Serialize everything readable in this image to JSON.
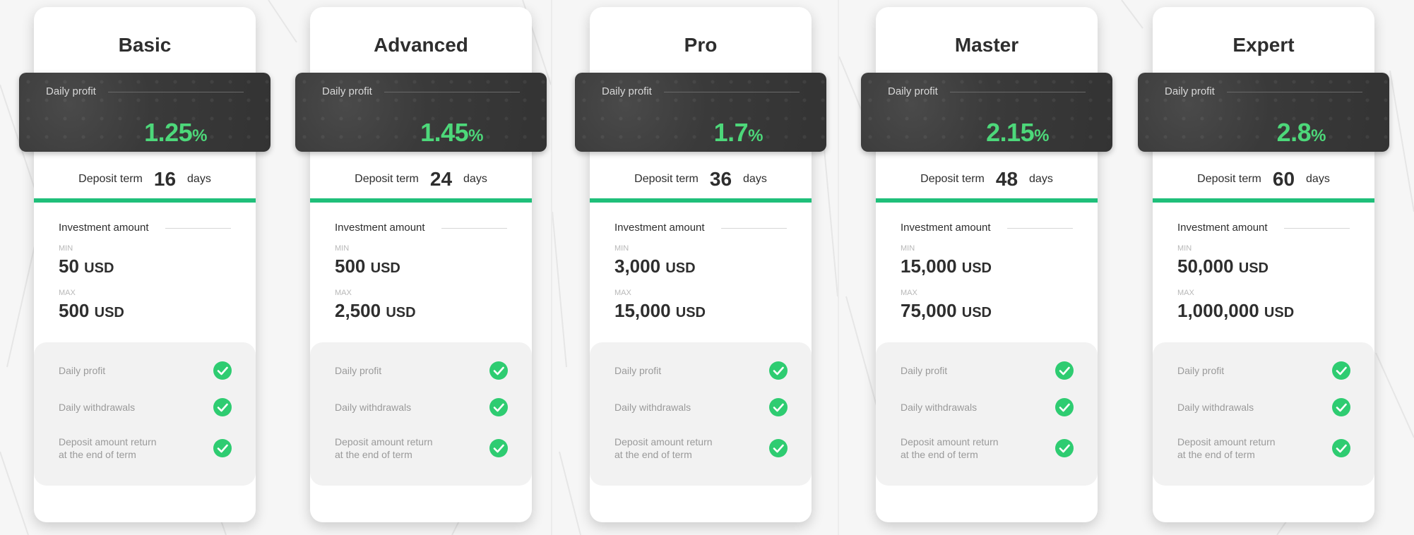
{
  "theme": {
    "accent": "#1fbf7a",
    "profit_color": "#4dd87a",
    "check_color": "#2ecc71",
    "panel_dark": "#383838"
  },
  "labels": {
    "daily_profit": "Daily profit",
    "deposit_term": "Deposit term",
    "days": "days",
    "investment_amount": "Investment amount",
    "min": "MIN",
    "max": "MAX",
    "currency": "USD",
    "percent": "%"
  },
  "features": [
    {
      "label": "Daily profit",
      "icon": "check-circle-icon"
    },
    {
      "label": "Daily withdrawals",
      "icon": "check-circle-icon"
    },
    {
      "label_line1": "Deposit amount return",
      "label_line2": "at the end of term",
      "icon": "check-circle-icon"
    }
  ],
  "plans": [
    {
      "name": "Basic",
      "daily_profit": "1.25",
      "term": "16",
      "min": "50",
      "max": "500"
    },
    {
      "name": "Advanced",
      "daily_profit": "1.45",
      "term": "24",
      "min": "500",
      "max": "2,500"
    },
    {
      "name": "Pro",
      "daily_profit": "1.7",
      "term": "36",
      "min": "3,000",
      "max": "15,000"
    },
    {
      "name": "Master",
      "daily_profit": "2.15",
      "term": "48",
      "min": "15,000",
      "max": "75,000"
    },
    {
      "name": "Expert",
      "daily_profit": "2.8",
      "term": "60",
      "min": "50,000",
      "max": "1,000,000"
    }
  ]
}
